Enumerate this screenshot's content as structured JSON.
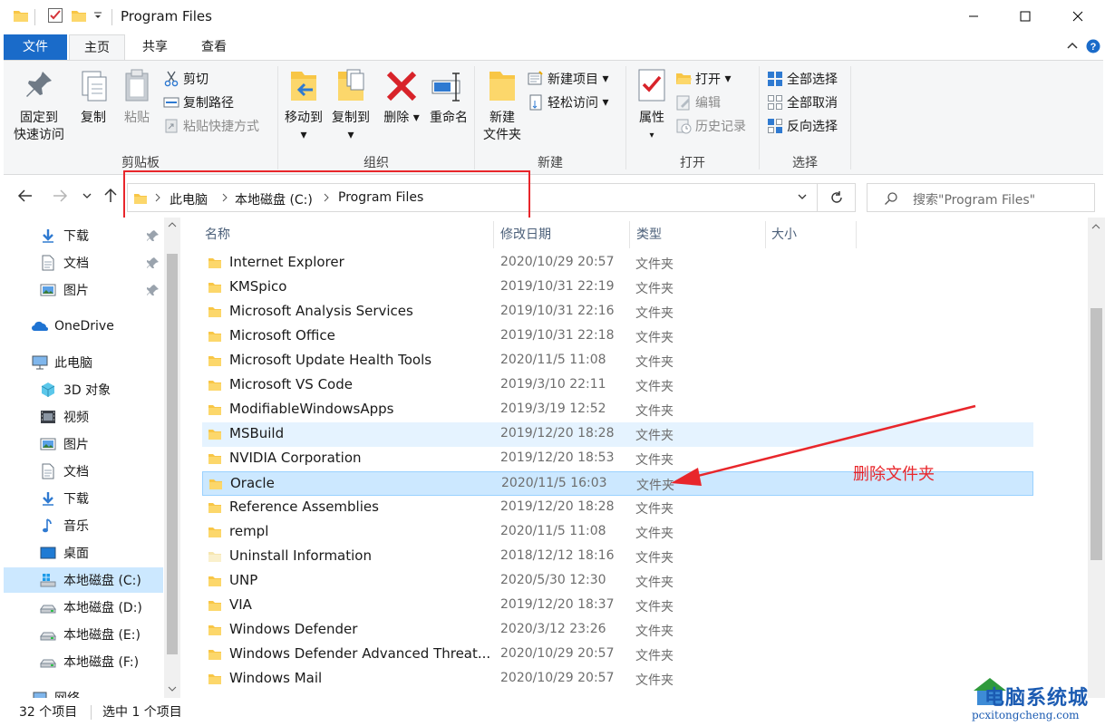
{
  "window": {
    "title": "Program Files",
    "minimize_icon": "minimize-icon",
    "maximize_icon": "maximize-icon",
    "close_icon": "close-icon"
  },
  "ribbon_tabs": [
    "文件",
    "主页",
    "共享",
    "查看"
  ],
  "ribbon": {
    "clipboard": {
      "label": "剪贴板",
      "pin": "固定到\n快速访问",
      "pin_line1": "固定到",
      "pin_line2": "快速访问",
      "copy": "复制",
      "paste": "粘贴",
      "cut": "剪切",
      "copy_path": "复制路径",
      "paste_shortcut": "粘贴快捷方式"
    },
    "organize": {
      "label": "组织",
      "move_to": "移动到",
      "copy_to": "复制到",
      "delete": "删除",
      "rename": "重命名"
    },
    "new": {
      "label": "新建",
      "new_folder_line1": "新建",
      "new_folder_line2": "文件夹",
      "new_item": "新建项目",
      "easy_access": "轻松访问"
    },
    "open": {
      "label": "打开",
      "properties": "属性",
      "open": "打开",
      "edit": "编辑",
      "history": "历史记录"
    },
    "select": {
      "label": "选择",
      "select_all": "全部选择",
      "select_none": "全部取消",
      "invert": "反向选择"
    }
  },
  "address": {
    "crumbs": [
      "此电脑",
      "本地磁盘 (C:)",
      "Program Files"
    ],
    "search_placeholder": "搜索\"Program Files\""
  },
  "nav": {
    "quick": [
      {
        "label": "下载",
        "icon": "download-icon"
      },
      {
        "label": "文档",
        "icon": "document-icon"
      },
      {
        "label": "图片",
        "icon": "picture-icon"
      }
    ],
    "onedrive": "OneDrive",
    "this_pc": "此电脑",
    "pc_items": [
      {
        "label": "3D 对象",
        "icon": "3d-objects-icon"
      },
      {
        "label": "视频",
        "icon": "video-icon"
      },
      {
        "label": "图片",
        "icon": "picture-icon"
      },
      {
        "label": "文档",
        "icon": "document-icon"
      },
      {
        "label": "下载",
        "icon": "download-icon"
      },
      {
        "label": "音乐",
        "icon": "music-icon"
      },
      {
        "label": "桌面",
        "icon": "desktop-icon"
      },
      {
        "label": "本地磁盘 (C:)",
        "icon": "windows-drive-icon"
      },
      {
        "label": "本地磁盘 (D:)",
        "icon": "drive-icon"
      },
      {
        "label": "本地磁盘 (E:)",
        "icon": "drive-icon"
      },
      {
        "label": "本地磁盘 (F:)",
        "icon": "drive-icon"
      }
    ],
    "network": "网络"
  },
  "columns": [
    "名称",
    "修改日期",
    "类型",
    "大小"
  ],
  "files": [
    {
      "name": "Internet Explorer",
      "date": "2020/10/29 20:57",
      "type": "文件夹"
    },
    {
      "name": "KMSpico",
      "date": "2019/10/31 22:19",
      "type": "文件夹"
    },
    {
      "name": "Microsoft Analysis Services",
      "date": "2019/10/31 22:16",
      "type": "文件夹"
    },
    {
      "name": "Microsoft Office",
      "date": "2019/10/31 22:18",
      "type": "文件夹"
    },
    {
      "name": "Microsoft Update Health Tools",
      "date": "2020/11/5 11:08",
      "type": "文件夹"
    },
    {
      "name": "Microsoft VS Code",
      "date": "2019/3/10 22:11",
      "type": "文件夹"
    },
    {
      "name": "ModifiableWindowsApps",
      "date": "2019/3/19 12:52",
      "type": "文件夹"
    },
    {
      "name": "MSBuild",
      "date": "2019/12/20 18:28",
      "type": "文件夹"
    },
    {
      "name": "NVIDIA Corporation",
      "date": "2019/12/20 18:53",
      "type": "文件夹"
    },
    {
      "name": "Oracle",
      "date": "2020/11/5 16:03",
      "type": "文件夹"
    },
    {
      "name": "Reference Assemblies",
      "date": "2019/12/20 18:28",
      "type": "文件夹"
    },
    {
      "name": "rempl",
      "date": "2020/11/5 11:08",
      "type": "文件夹"
    },
    {
      "name": "Uninstall Information",
      "date": "2018/12/12 18:16",
      "type": "文件夹"
    },
    {
      "name": "UNP",
      "date": "2020/5/30 12:30",
      "type": "文件夹"
    },
    {
      "name": "VIA",
      "date": "2019/12/20 18:37",
      "type": "文件夹"
    },
    {
      "name": "Windows Defender",
      "date": "2020/3/12 23:26",
      "type": "文件夹"
    },
    {
      "name": "Windows Defender Advanced Threat...",
      "date": "2020/10/29 20:57",
      "type": "文件夹"
    },
    {
      "name": "Windows Mail",
      "date": "2020/10/29 20:57",
      "type": "文件夹"
    }
  ],
  "annotation": {
    "text": "删除文件夹",
    "color": "#e8262b"
  },
  "status": {
    "count": "32 个项目",
    "selected": "选中 1 个项目"
  },
  "watermark": {
    "text": "电脑系统城",
    "url": "pcxitongcheng.com"
  },
  "colors": {
    "accent": "#1a6bc9",
    "selection": "#cce8ff",
    "hover": "#e5f3ff",
    "folder": "#f8c646"
  }
}
